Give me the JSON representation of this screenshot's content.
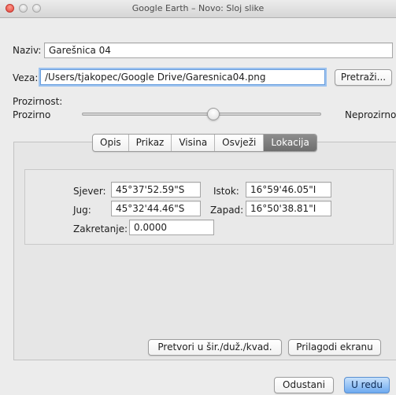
{
  "window": {
    "title": "Google Earth – Novo: Sloj slike"
  },
  "name": {
    "label": "Naziv:",
    "value": "Garešnica 04"
  },
  "link": {
    "label": "Veza:",
    "value": "/Users/tjakopec/Google Drive/Garesnica04.png",
    "browse_label": "Pretraži..."
  },
  "opacity": {
    "label": "Prozirnost:",
    "min_label": "Prozirno",
    "max_label": "Neprozirno",
    "value_fraction": 0.55
  },
  "tabs": [
    "Opis",
    "Prikaz",
    "Visina",
    "Osvježi",
    "Lokacija"
  ],
  "active_tab": "Lokacija",
  "location": {
    "north_label": "Sjever:",
    "north_value": "45°37'52.59\"S",
    "east_label": "Istok:",
    "east_value": "16°59'46.05\"I",
    "south_label": "Jug:",
    "south_value": "45°32'44.46\"S",
    "west_label": "Zapad:",
    "west_value": "16°50'38.81\"I",
    "rotation_label": "Zakretanje:",
    "rotation_value": "0.0000"
  },
  "actions": {
    "convert_label": "Pretvori u šir./duž./kvad.",
    "fit_label": "Prilagodi ekranu",
    "cancel_label": "Odustani",
    "ok_label": "U redu"
  }
}
